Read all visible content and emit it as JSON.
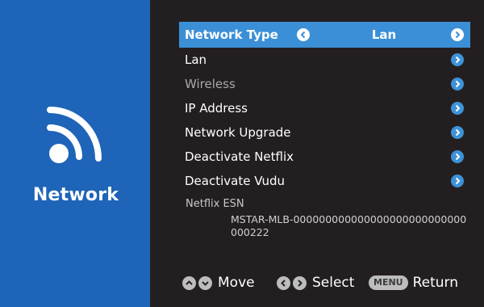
{
  "sidebar": {
    "title": "Network",
    "icon": "wifi-icon",
    "background": "#1e64b8"
  },
  "menu": {
    "network_type": {
      "label": "Network Type",
      "value": "Lan"
    },
    "items": [
      {
        "label": "Lan",
        "enabled": true
      },
      {
        "label": "Wireless",
        "enabled": false
      },
      {
        "label": "IP Address",
        "enabled": true
      },
      {
        "label": "Network Upgrade",
        "enabled": true
      },
      {
        "label": "Deactivate Netflix",
        "enabled": true
      },
      {
        "label": "Deactivate Vudu",
        "enabled": true
      }
    ]
  },
  "esn": {
    "label": "Netflix ESN",
    "value": "MSTAR-MLB-000000000000000000000000000000222"
  },
  "footer": {
    "move_label": "Move",
    "select_label": "Select",
    "menu_key": "MENU",
    "return_label": "Return"
  },
  "colors": {
    "accent": "#3b8fd6",
    "background": "#231f20",
    "arrow": "#3d92d8"
  }
}
